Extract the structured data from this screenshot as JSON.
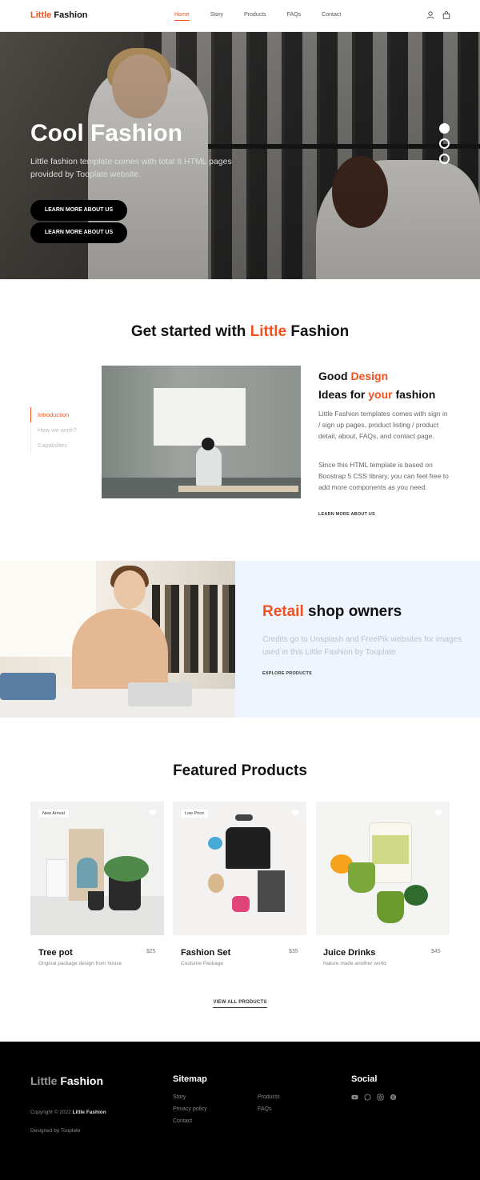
{
  "nav": {
    "brand_part1": "Little",
    "brand_part2": "Fashion",
    "items": [
      {
        "label": "Home"
      },
      {
        "label": "Story"
      },
      {
        "label": "Products"
      },
      {
        "label": "FAQs"
      },
      {
        "label": "Contact"
      }
    ],
    "icons": [
      "user-icon",
      "shopping-bag-icon"
    ]
  },
  "hero": {
    "title": "Cool Fashion",
    "text": "Little fashion template comes with total 8 HTML pages provided by Tooplate website.",
    "buttons": [
      "LEARN MORE ABOUT US",
      "LEARN MORE ABOUT US"
    ],
    "slides": 3,
    "active_slide": 1
  },
  "get_started": {
    "title_pre": "Get started with ",
    "title_accent": "Little",
    "title_post": " Fashion",
    "side_nav": [
      "Introduction",
      "How we work?",
      "Capabilites"
    ],
    "heading_line1_a": "Good ",
    "heading_line1_b": "Design",
    "heading_line2_a": "Ideas for ",
    "heading_line2_b": "your",
    "heading_line2_c": " fashion",
    "para1": "Little Fashion templates comes with sign in / sign up pages, product listing / product detail, about, FAQs, and contact page.",
    "para2": "Since this HTML template is based on Boostrap 5 CSS library, you can feel free to add more components as you need.",
    "link": "LEARN MORE ABOUT US"
  },
  "retail": {
    "heading_accent": "Retail",
    "heading_rest": " shop owners",
    "text": "Credits go to Unsplash and FreePik websites for images used in this Little Fashion by Tooplate.",
    "link": "EXPLORE PRODUCTS"
  },
  "featured": {
    "title": "Featured Products",
    "products": [
      {
        "name": "Tree pot",
        "desc": "Original package design from house",
        "price": "$25",
        "badge": "New Arrival"
      },
      {
        "name": "Fashion Set",
        "desc": "Costume Package",
        "price": "$35",
        "badge": "Low Price"
      },
      {
        "name": "Juice Drinks",
        "desc": "Nature made another world",
        "price": "$45",
        "badge": ""
      }
    ],
    "view_all": "VIEW ALL PRODUCTS"
  },
  "footer": {
    "brand_part1": "Little",
    "brand_part2": "Fashion",
    "copyright_pre": "Copyright © 2022 ",
    "copyright_brand": "Little Fashion",
    "designed": "Designed by Tooplate",
    "sitemap_title": "Sitemap",
    "sitemap_col1": [
      "Story",
      "Privacy policy",
      "Contact"
    ],
    "sitemap_col2": [
      "Products",
      "FAQs"
    ],
    "social_title": "Social",
    "social_icons": [
      "youtube-icon",
      "whatsapp-icon",
      "instagram-icon",
      "skype-icon"
    ]
  },
  "colors": {
    "accent": "#f4511e",
    "footer_bg": "#000000",
    "retail_panel_bg": "#eef5fe"
  }
}
